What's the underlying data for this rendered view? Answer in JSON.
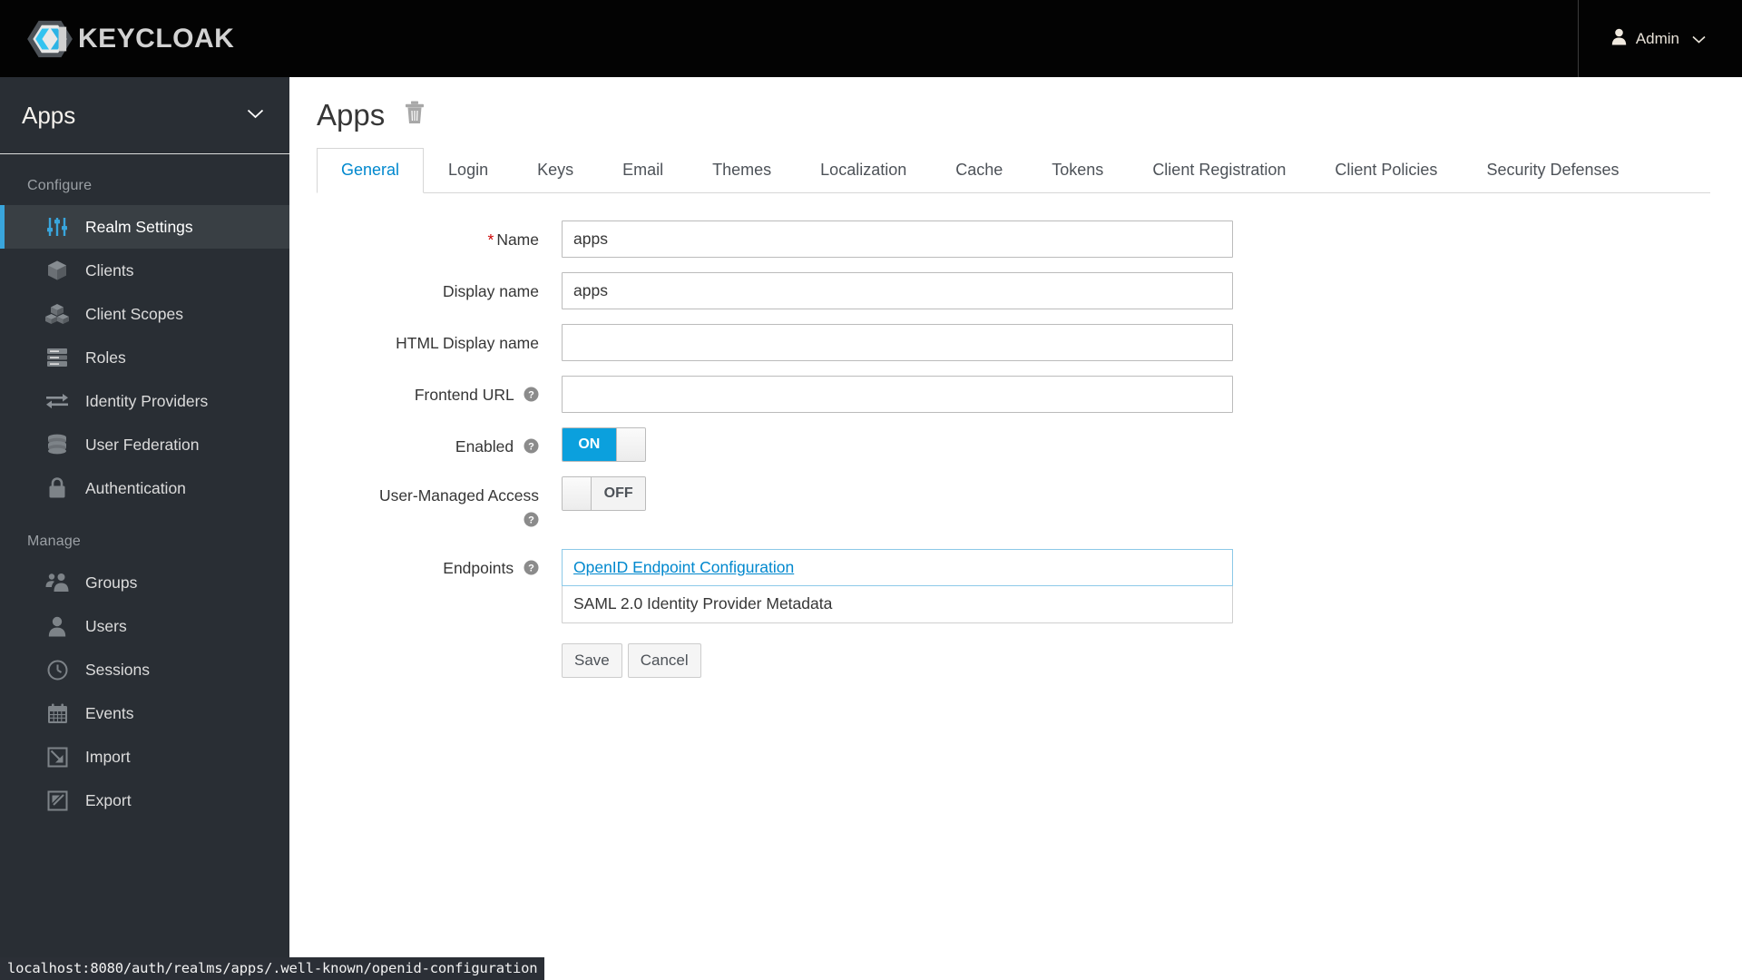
{
  "masthead": {
    "brand_text": "KEYCLOAK",
    "brand_icon": "keycloak-logo",
    "user_icon": "user-icon",
    "user_label": "Admin",
    "caret_icon": "chevron-down-icon"
  },
  "sidebar": {
    "realm": {
      "name": "Apps",
      "caret_icon": "chevron-down-icon"
    },
    "sections": [
      {
        "label": "Configure",
        "items": [
          {
            "label": "Realm Settings",
            "icon": "sliders-icon",
            "active": true
          },
          {
            "label": "Clients",
            "icon": "cube-icon",
            "active": false
          },
          {
            "label": "Client Scopes",
            "icon": "cubes-icon",
            "active": false
          },
          {
            "label": "Roles",
            "icon": "server-rows-icon",
            "active": false
          },
          {
            "label": "Identity Providers",
            "icon": "exchange-arrows-icon",
            "active": false
          },
          {
            "label": "User Federation",
            "icon": "database-icon",
            "active": false
          },
          {
            "label": "Authentication",
            "icon": "lock-icon",
            "active": false
          }
        ]
      },
      {
        "label": "Manage",
        "items": [
          {
            "label": "Groups",
            "icon": "users-icon",
            "active": false
          },
          {
            "label": "Users",
            "icon": "user-icon",
            "active": false
          },
          {
            "label": "Sessions",
            "icon": "clock-icon",
            "active": false
          },
          {
            "label": "Events",
            "icon": "calendar-icon",
            "active": false
          },
          {
            "label": "Import",
            "icon": "import-arrow-icon",
            "active": false
          },
          {
            "label": "Export",
            "icon": "export-arrow-icon",
            "active": false
          }
        ]
      }
    ]
  },
  "page": {
    "title": "Apps",
    "delete_icon": "trash-icon",
    "tabs": [
      {
        "label": "General",
        "active": true
      },
      {
        "label": "Login",
        "active": false
      },
      {
        "label": "Keys",
        "active": false
      },
      {
        "label": "Email",
        "active": false
      },
      {
        "label": "Themes",
        "active": false
      },
      {
        "label": "Localization",
        "active": false
      },
      {
        "label": "Cache",
        "active": false
      },
      {
        "label": "Tokens",
        "active": false
      },
      {
        "label": "Client Registration",
        "active": false
      },
      {
        "label": "Client Policies",
        "active": false
      },
      {
        "label": "Security Defenses",
        "active": false
      }
    ]
  },
  "form": {
    "name": {
      "label": "Name",
      "required_marker": "*",
      "value": "apps",
      "placeholder": ""
    },
    "display_name": {
      "label": "Display name",
      "value": "apps",
      "placeholder": ""
    },
    "html_display_name": {
      "label": "HTML Display name",
      "value": "",
      "placeholder": ""
    },
    "frontend_url": {
      "label": "Frontend URL",
      "value": "",
      "placeholder": "",
      "help_icon": "help-circle-icon"
    },
    "enabled": {
      "label": "Enabled",
      "state": "ON",
      "on": true,
      "help_icon": "help-circle-icon"
    },
    "user_managed_access": {
      "label": "User-Managed Access",
      "state": "OFF",
      "on": false,
      "help_icon": "help-circle-icon"
    },
    "endpoints": {
      "label": "Endpoints",
      "help_icon": "help-circle-icon",
      "items": [
        {
          "label": "OpenID Endpoint Configuration",
          "is_link": true,
          "hovered": true
        },
        {
          "label": "SAML 2.0 Identity Provider Metadata",
          "is_link": false,
          "hovered": false
        }
      ]
    },
    "buttons": {
      "save": "Save",
      "cancel": "Cancel"
    }
  },
  "status_bar": {
    "url": "localhost:8080/auth/realms/apps/.well-known/openid-configuration"
  },
  "colors": {
    "accent_blue": "#0088ce",
    "toggle_on": "#0ba0dd",
    "sidebar_bg": "#292e34",
    "sidebar_active_bg": "#393f44",
    "active_bar": "#39a5dc",
    "masthead_bg": "#030303",
    "required_red": "#cc0000"
  }
}
